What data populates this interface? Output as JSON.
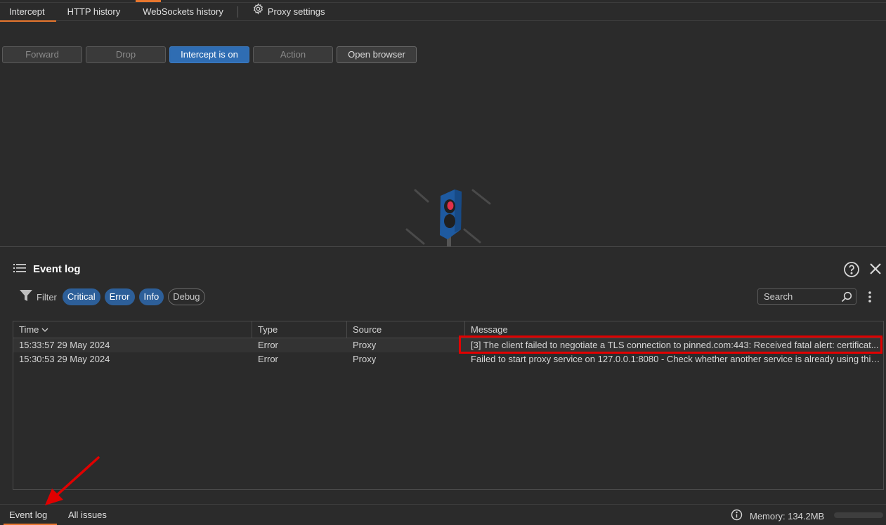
{
  "tabs": {
    "intercept": "Intercept",
    "http_history": "HTTP history",
    "websockets_history": "WebSockets history",
    "proxy_settings": "Proxy settings"
  },
  "toolbar": {
    "forward": "Forward",
    "drop": "Drop",
    "intercept": "Intercept is on",
    "action": "Action",
    "open_browser": "Open browser"
  },
  "event_log": {
    "title": "Event log",
    "filter_label": "Filter",
    "filters": [
      {
        "label": "Critical",
        "active": true
      },
      {
        "label": "Error",
        "active": true
      },
      {
        "label": "Info",
        "active": true
      },
      {
        "label": "Debug",
        "active": false
      }
    ],
    "search_placeholder": "Search",
    "columns": [
      "Time",
      "Type",
      "Source",
      "Message"
    ],
    "rows": [
      {
        "time": "15:33:57 29 May 2024",
        "type": "Error",
        "source": "Proxy",
        "message": "[3]  The client failed to negotiate a TLS connection to pinned.com:443: Received fatal alert: certificat..."
      },
      {
        "time": "15:30:53 29 May 2024",
        "type": "Error",
        "source": "Proxy",
        "message": "Failed to start proxy service on 127.0.0.1:8080 - Check whether another service is already using this ..."
      }
    ]
  },
  "bottom": {
    "event_log": "Event log",
    "all_issues": "All issues",
    "memory": "Memory: 134.2MB"
  },
  "colors": {
    "accent": "#e8772e",
    "primary": "#2f6db3",
    "highlight": "#e00000"
  }
}
